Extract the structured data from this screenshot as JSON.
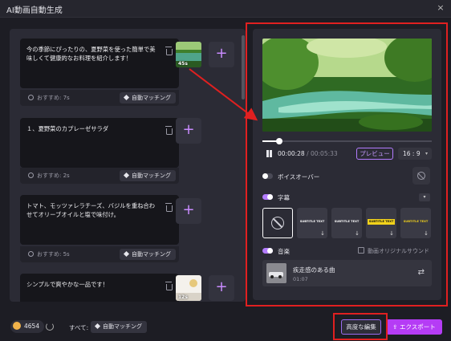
{
  "window": {
    "title": "AI動画自動生成",
    "close": "×"
  },
  "scenes": [
    {
      "text": "今の季節にぴったりの、夏野菜を使った簡単で美味しくて健康的なお料理を紹介します！",
      "recommend": "おすすめ: 7s",
      "match": "自動マッチング",
      "thumb_duration": "45s",
      "has_thumb": true
    },
    {
      "text": "１、夏野菜のカプレーゼサラダ",
      "recommend": "おすすめ: 2s",
      "match": "自動マッチング",
      "has_thumb": false
    },
    {
      "text": "トマト、モッツァレラチーズ、バジルを重ね合わせてオリーブオイルと塩で味付け。",
      "recommend": "おすすめ: 5s",
      "match": "自動マッチング",
      "has_thumb": false
    },
    {
      "text": "シンプルで爽やかな一品です！",
      "thumb_duration": "12s",
      "has_thumb": true
    }
  ],
  "add_label": "+",
  "player": {
    "current": "00:00:28",
    "total": "/ 00:05:33",
    "progress": 0.1,
    "preview_label": "プレビュー",
    "ratio": "16 : 9",
    "ratio_chevron": "▾"
  },
  "voiceover": {
    "label": "ボイスオーバー",
    "enabled": false
  },
  "subtitles": {
    "label": "字幕",
    "enabled": true,
    "styles": [
      {
        "text": "SUBTITLE TEXT",
        "color": "#ffffff",
        "bg": "#3a3a45"
      },
      {
        "text": "SUBTITLE TEXT",
        "color": "#ffffff",
        "bg": "#3a3a45"
      },
      {
        "text": "SUBTITLE TEXT",
        "color": "#111111",
        "bg": "#f2d21b"
      },
      {
        "text": "SUBTITLE TEXT",
        "color": "#f2d21b",
        "bg": "#3a3a45"
      }
    ],
    "download_icon": "↓"
  },
  "music": {
    "label": "音楽",
    "enabled": true,
    "original_sound_label": "動画オリジナルサウンド",
    "track_title": "疾走感のある曲",
    "track_duration": "01:07",
    "swap_icon": "⇄"
  },
  "footer": {
    "credits": "4654",
    "all_label": "すべて:",
    "all_match": "自動マッチング",
    "advanced_edit": "高度な編集",
    "export": "エクスポート",
    "export_icon": "⇪"
  },
  "colors": {
    "accent": "#b53cf5",
    "highlight": "#e02020",
    "toggle_on": "#b37cff"
  }
}
